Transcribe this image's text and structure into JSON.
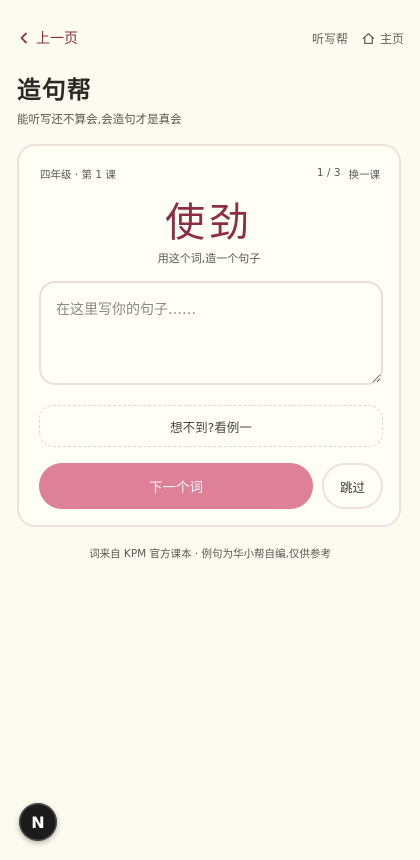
{
  "nav": {
    "back_label": "上一页",
    "helper_label": "听写帮",
    "home_label": "主页"
  },
  "header": {
    "title": "造句帮",
    "subtitle": "能听写还不算会,会造句才是真会"
  },
  "card": {
    "lesson": "四年级 · 第 1 课",
    "progress": "1 / 3",
    "switch_label": "换一课",
    "word": "使劲",
    "instruction": "用这个词,造一个句子",
    "input_value": "",
    "input_placeholder": "在这里写你的句子……",
    "example_label": "想不到?看例一",
    "next_label": "下一个词",
    "skip_label": "跳过"
  },
  "footer": {
    "note": "词来自 KPM 官方课本 · 例句为华小帮自编,仅供参考"
  },
  "badge": {
    "letter": "N"
  },
  "colors": {
    "background": "#fbfcef",
    "accent": "#8c2f46",
    "primary_button": "#de8198"
  }
}
